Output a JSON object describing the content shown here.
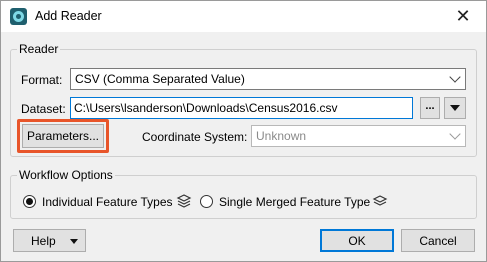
{
  "window": {
    "title": "Add Reader",
    "close_glyph": "✕"
  },
  "reader_group": {
    "legend": "Reader",
    "format_label": "Format:",
    "format_value": "CSV (Comma Separated Value)",
    "dataset_label": "Dataset:",
    "dataset_value": "C:\\Users\\lsanderson\\Downloads\\Census2016.csv",
    "browse_label": "...",
    "parameters_label": "Parameters...",
    "coord_label": "Coordinate System:",
    "coord_value": "Unknown"
  },
  "workflow_group": {
    "legend": "Workflow Options",
    "option_individual": "Individual Feature Types",
    "option_merged": "Single Merged Feature Type",
    "selected": "Individual Feature Types"
  },
  "footer": {
    "help_label": "Help",
    "ok_label": "OK",
    "cancel_label": "Cancel"
  },
  "colors": {
    "highlight": "#e8552a",
    "focus": "#0078d7"
  },
  "icons": {
    "app": "fme-app-icon",
    "close": "close-icon",
    "layers": "layers-icon",
    "dropdown": "chevron-down-icon"
  }
}
